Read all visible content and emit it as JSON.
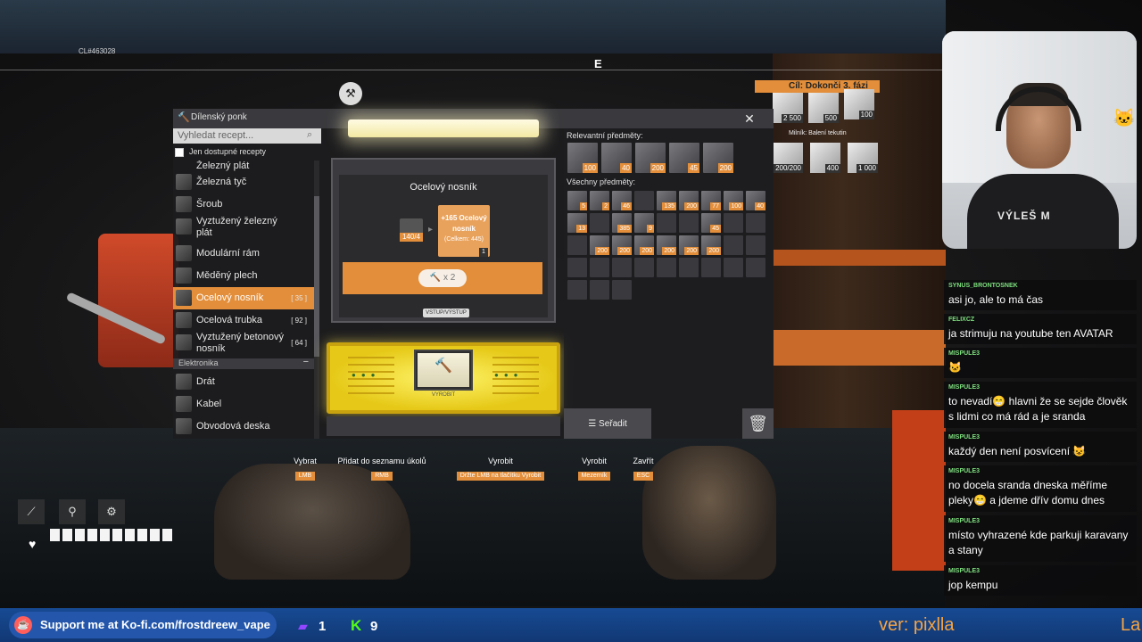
{
  "hud": {
    "coords": "CL#463028",
    "compass_heading": "E",
    "goal": "Cíl: Dokonči 3. fázi",
    "milestone": "Milník: Balení tekutin",
    "goal_items": [
      {
        "qty": "2 500",
        "icon": "beam-bundle-icon"
      },
      {
        "qty": "500",
        "icon": "plate-stack-icon"
      },
      {
        "qty": "100",
        "icon": "gear-wheel-icon"
      }
    ],
    "milestone_items": [
      {
        "qty": "200/200",
        "icon": "gauge-icon"
      },
      {
        "qty": "400",
        "icon": "plate-stack-icon"
      },
      {
        "qty": "1 000",
        "icon": "pipe-bundle-icon"
      }
    ]
  },
  "window": {
    "title": "Dílenský ponk",
    "close": "✕"
  },
  "sidebar": {
    "search_placeholder": "Vyhledat recept...",
    "filter_label": "Jen dostupné recepty",
    "items": [
      {
        "label": "Železný plát",
        "count": ""
      },
      {
        "label": "Železná tyč",
        "count": ""
      },
      {
        "label": "Šroub",
        "count": ""
      },
      {
        "label": "Vyztužený železný plát",
        "count": ""
      },
      {
        "label": "Modulární rám",
        "count": ""
      },
      {
        "label": "Měděný plech",
        "count": ""
      },
      {
        "label": "Ocelový nosník",
        "count": "[ 35 ]"
      },
      {
        "label": "Ocelová trubka",
        "count": "[ 92 ]"
      },
      {
        "label": "Vyztužený betonový nosník",
        "count": "[ 64 ]"
      }
    ],
    "category": "Elektronika",
    "category_toggle": "−",
    "electronics": [
      {
        "label": "Drát"
      },
      {
        "label": "Kabel"
      },
      {
        "label": "Obvodová deska"
      }
    ]
  },
  "craft": {
    "recipe_name": "Ocelový nosník",
    "ingredient_count": "140/4",
    "output_line1": "+165 Ocelový",
    "output_line2": "nosník",
    "output_total": "(Celkem: 445)",
    "output_qty": "1",
    "multiplier": "x 2",
    "io_label": "VSTUP/VÝSTUP",
    "produce_label": "VYROBIT"
  },
  "inventory": {
    "relevant_label": "Relevantní předměty:",
    "relevant": [
      "100",
      "40",
      "200",
      "45",
      "200"
    ],
    "all_label": "Všechny předměty:",
    "row1": [
      "5",
      "2",
      "46",
      "",
      "135",
      "200",
      "77",
      "100",
      "40"
    ],
    "row2": [
      "13",
      "",
      "385",
      "9",
      "",
      "",
      "45",
      "",
      ""
    ],
    "row3": [
      "",
      "200",
      "200",
      "200",
      "200",
      "200",
      "200",
      "",
      ""
    ],
    "sort_label": "Seřadit"
  },
  "hints": [
    {
      "action": "Vybrat",
      "key": "LMB"
    },
    {
      "action": "Přidat do seznamu úkolů",
      "key": "RMB"
    },
    {
      "action": "Vyrobit",
      "key": "Držte LMB na tlačítku Vyrobit"
    },
    {
      "action": "Vyrobit",
      "key": "Mezerník"
    },
    {
      "action": "Zavřít",
      "key": "ESC"
    }
  ],
  "chat": [
    {
      "user": "SYNUS_BRONTOSNEK",
      "text": "asi jo, ale to má čas"
    },
    {
      "user": "FELIXCZ",
      "text": "ja strimuju na youtube ten AVATAR"
    },
    {
      "user": "MISPULE3",
      "text": "🐱"
    },
    {
      "user": "MISPULE3",
      "text": "to nevadí😁 hlavni že se sejde člověk s lidmi co má rád a je sranda"
    },
    {
      "user": "MISPULE3",
      "text": "každý den není posvícení 😺"
    },
    {
      "user": "MISPULE3",
      "text": "no docela sranda dneska měříme pleky😁 a jdeme dřív domu dnes"
    },
    {
      "user": "MISPULE3",
      "text": "místo vyhrazené kde parkuji karavany a stany"
    },
    {
      "user": "MISPULE3",
      "text": "jop kempu"
    }
  ],
  "stream": {
    "kofi_text": "Support me at Ko-fi.com/frostdreew_vape",
    "twitch_viewers": "1",
    "kick_viewers": "9",
    "ticker_text": "ver: pixlla",
    "ticker_tail": "La",
    "webcam_shirt": "VÝLEŠ M"
  },
  "colors": {
    "accent": "#e38e3a",
    "produce_panel": "#f5e23a",
    "chat_username": "#7ee07e",
    "bottom_bar": "#174a93"
  }
}
